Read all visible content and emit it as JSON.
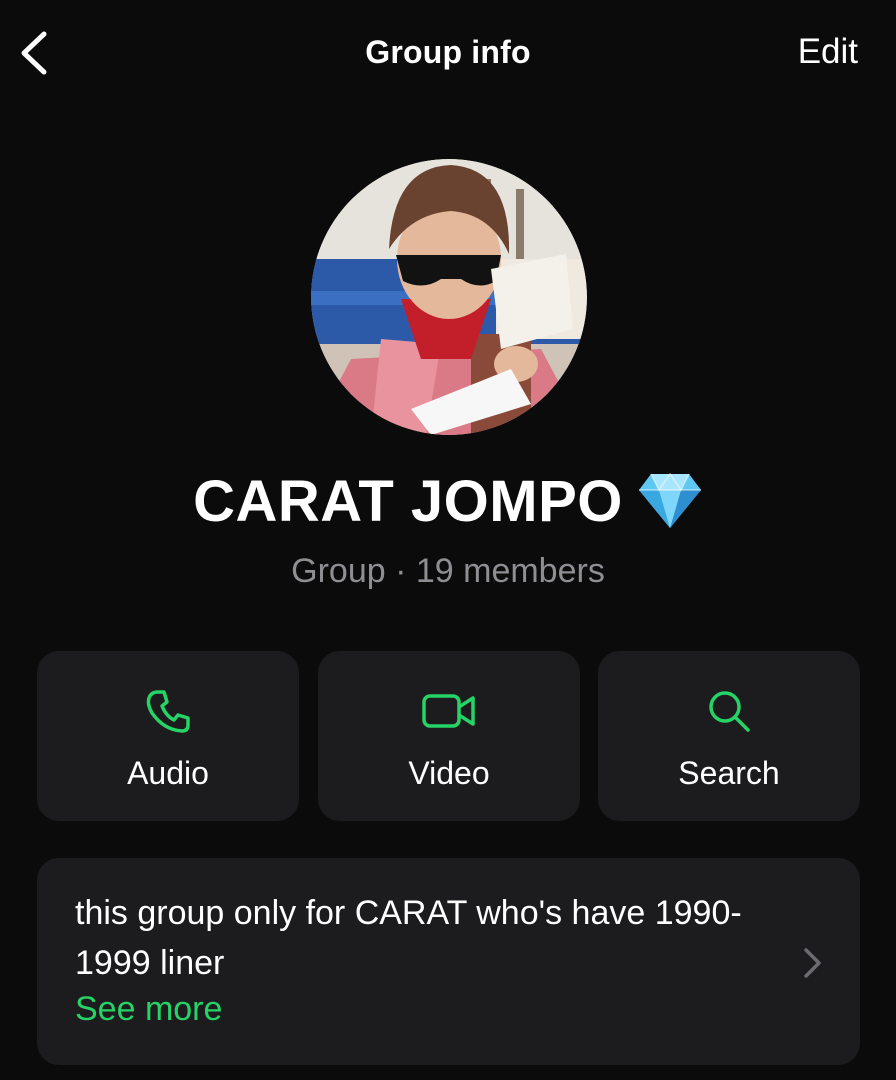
{
  "header": {
    "title": "Group info",
    "edit_label": "Edit"
  },
  "group": {
    "name": "CARAT JOMPO",
    "name_emoji": "diamond-icon",
    "subtitle": "Group · 19 members"
  },
  "actions": [
    {
      "label": "Audio",
      "icon": "phone-icon"
    },
    {
      "label": "Video",
      "icon": "video-camera-icon"
    },
    {
      "label": "Search",
      "icon": "search-icon"
    }
  ],
  "description": {
    "text": "this group only for CARAT who's have 1990-1999 liner",
    "see_more_label": "See more"
  },
  "colors": {
    "background": "#0b0b0b",
    "card": "#1c1c1e",
    "accent_green": "#25d366",
    "secondary_text": "#8e8e93"
  }
}
